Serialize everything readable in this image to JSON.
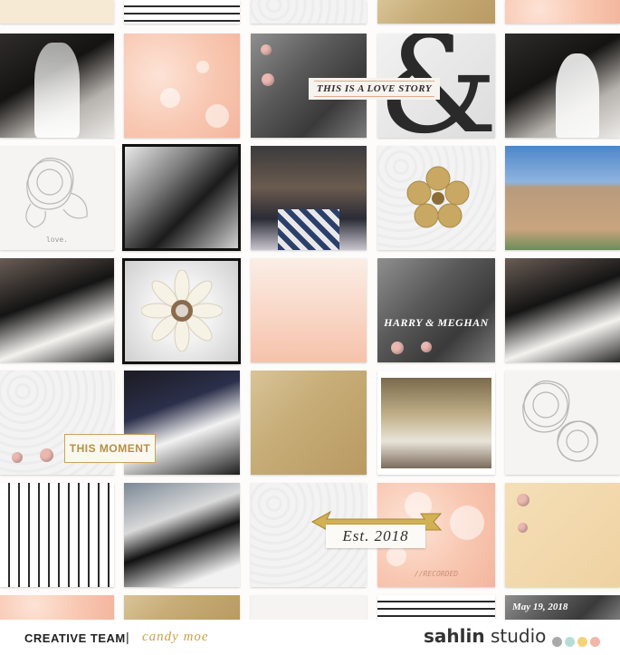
{
  "page": {
    "tiles": {
      "love_story_label": "THIS IS A LOVE STORY",
      "love_caption": "love.",
      "names_title": "HARRY & MEGHAN",
      "moment_label": "THIS MOMENT",
      "est_label": "Est. 2018",
      "recorded_label": "//RECORDED",
      "date_label": "May 19, 2018"
    }
  },
  "footer": {
    "creative_team_label": "CREATIVE TEAM",
    "separator": "|",
    "designer_name": "candy moe",
    "brand_part1": "sahlin",
    "brand_part2": " studio",
    "brand_dot_colors": [
      "#a9a9a9",
      "#b8ddd6",
      "#f4d27a",
      "#f2b7a7"
    ]
  },
  "icons": {
    "ampersand": "ampersand-icon",
    "flower_sketch": "flower-sketch-icon",
    "gold_flower": "gold-flower-icon",
    "daisy": "daisy-icon",
    "arrow": "gold-arrow-icon"
  }
}
